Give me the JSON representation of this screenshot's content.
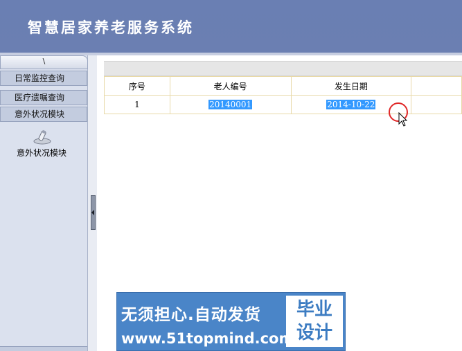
{
  "header": {
    "title": "智慧居家养老服务系统"
  },
  "sidebar": {
    "tab_label": "\\",
    "items": [
      {
        "label": "日常监控查询"
      },
      {
        "label": "医疗遗嘱查询"
      },
      {
        "label": "意外状况模块"
      }
    ],
    "module": {
      "label": "意外状况模块",
      "icon": "module-icon"
    }
  },
  "table": {
    "headers": [
      "序号",
      "老人编号",
      "发生日期",
      ""
    ],
    "rows": [
      {
        "index": "1",
        "elder_id": "20140001",
        "date": "2014-10-22"
      }
    ]
  },
  "watermark": {
    "line1": "无须担心.自动发货",
    "line2": "www.51topmind.com",
    "side_line1": "毕业",
    "side_line2": "设计"
  },
  "colors": {
    "header_bg": "#6a7fb3",
    "sidebar_bg": "#dbe1ee",
    "selection": "#3399ff",
    "watermark_bg": "#4a85c8"
  }
}
